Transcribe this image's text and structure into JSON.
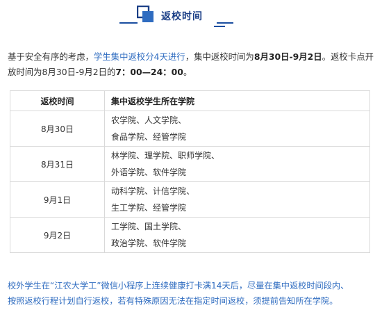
{
  "header": {
    "title": "返校时间",
    "icon": "bracket-square-icon",
    "accent": "#1a4ea0"
  },
  "intro": {
    "part1": "基于安全有序的考虑，",
    "part2_blue": "学生集中返校分4天进行",
    "part3": "，集中返校时间为",
    "part4_bold": "8月30日-9月2日",
    "part5": "。返校卡点开放时间为8月30日-9月2日的",
    "part6_bold": "7：00—24：00",
    "part7": "。"
  },
  "table": {
    "headers": [
      "返校时间",
      "集中返校学生所在学院"
    ],
    "rows": [
      {
        "date": "8月30日",
        "line1": "农学院、人文学院、",
        "line2": "食品学院、经管学院"
      },
      {
        "date": "8月31日",
        "line1": "林学院、理学院、职师学院、",
        "line2": "外语学院、软件学院"
      },
      {
        "date": "9月1日",
        "line1": "动科学院、计信学院、",
        "line2": "生工学院、经管学院"
      },
      {
        "date": "9月2日",
        "line1": "工学院、国土学院、",
        "line2": "政治学院、软件学院"
      }
    ]
  },
  "footer": {
    "line1": "校外学生在“江农大学工”微信小程序上连续健康打卡满14天后，尽量在集中返校时间段内、",
    "line2": "按照返校行程计划自行返校，若有特殊原因无法在指定时间返校，须提前告知所在学院。"
  }
}
